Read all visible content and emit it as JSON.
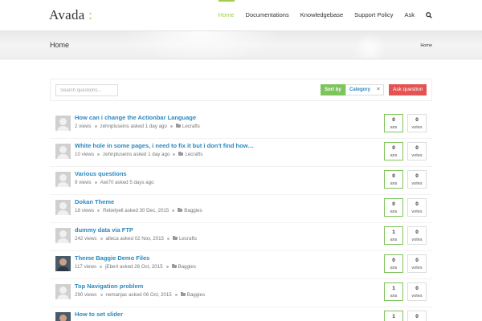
{
  "header": {
    "logo_text": "Avada",
    "logo_accent": " :",
    "nav": [
      {
        "label": "Home",
        "active": true
      },
      {
        "label": "Documentations",
        "active": false
      },
      {
        "label": "Knowledgebase",
        "active": false
      },
      {
        "label": "Support Policy",
        "active": false
      },
      {
        "label": "Ask",
        "active": false
      }
    ],
    "search_icon": "search-icon"
  },
  "titlebar": {
    "title": "Home",
    "breadcrumb": "Home"
  },
  "filter": {
    "search_placeholder": "Search questions...",
    "sort_label": "Sort by",
    "category_label": "Category",
    "clear_icon": "×",
    "ask_label": "Ask question"
  },
  "questions": [
    {
      "title": "How can i change the Actionbar Language",
      "views": "2 views",
      "author": "zehnpluseins asked 1 day ago",
      "category": "Lecrafts",
      "answers": "0",
      "answers_label": "ans",
      "votes": "0",
      "votes_label": "votes"
    },
    {
      "title": "White hole in some pages, i need to fix it but i don't find how…",
      "views": "10 views",
      "author": "zehnpluseins asked 1 day ago",
      "category": "Lecrafts",
      "answers": "0",
      "answers_label": "ans",
      "votes": "0",
      "votes_label": "votes"
    },
    {
      "title": "Various questions",
      "views": "9 views",
      "author": "Awi70 asked 5 days ago",
      "category": "",
      "answers": "0",
      "answers_label": "ans",
      "votes": "0",
      "votes_label": "votes"
    },
    {
      "title": "Dokan Theme",
      "views": "18 views",
      "author": "Rebelyell asked 30 Dec, 2015",
      "category": "Baggies",
      "answers": "0",
      "answers_label": "ans",
      "votes": "0",
      "votes_label": "votes"
    },
    {
      "title": "dummy data via FTP",
      "views": "242 views",
      "author": "alleca asked 02 Nov, 2015",
      "category": "Lecrafts",
      "answers": "1",
      "answers_label": "ans",
      "votes": "0",
      "votes_label": "votes"
    },
    {
      "title": "Theme Baggie Demo Files",
      "views": "117 views",
      "author": "jEbert asked 26 Oct, 2015",
      "category": "Baggies",
      "answers": "0",
      "answers_label": "ans",
      "votes": "0",
      "votes_label": "votes"
    },
    {
      "title": "Top Navigation problem",
      "views": "290 views",
      "author": "nemanjac asked 06 Oct, 2015",
      "category": "Baggies",
      "answers": "1",
      "answers_label": "ans",
      "votes": "0",
      "votes_label": "votes"
    },
    {
      "title": "How to set slider",
      "views": "",
      "author": "",
      "category": "",
      "answers": "1",
      "answers_label": "ans",
      "votes": "0",
      "votes_label": "votes"
    }
  ],
  "colors": {
    "accent": "#a0ce4e",
    "link": "#2a88c0",
    "sort_button": "#7ec45c",
    "ask_button": "#e45353"
  }
}
